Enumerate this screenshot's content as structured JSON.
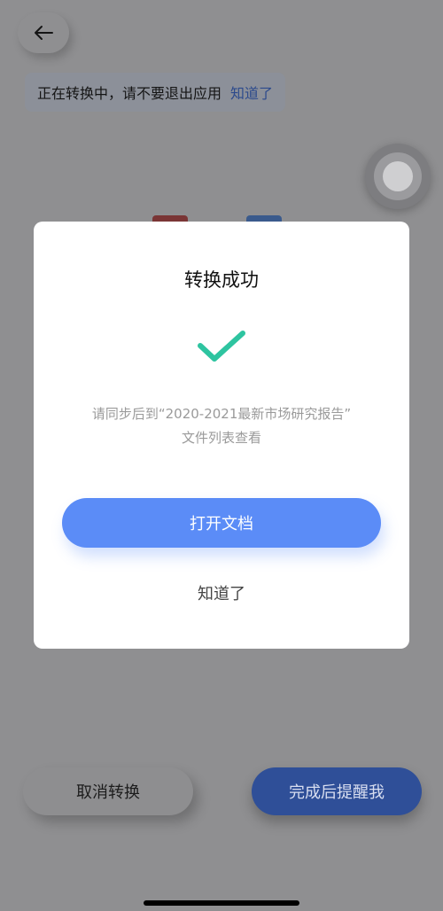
{
  "notice": {
    "text": "正在转换中，请不要退出应用",
    "link": "知道了"
  },
  "icons": {
    "back": "arrow-left-icon",
    "floating": "floating-ball-icon",
    "success": "checkmark-icon"
  },
  "modal": {
    "title": "转换成功",
    "message_line1": "请同步后到“2020-2021最新市场研究报告”",
    "message_line2": "文件列表查看",
    "open_button": "打开文档",
    "dismiss_button": "知道了"
  },
  "bottom": {
    "cancel_button": "取消转换",
    "remind_button": "完成后提醒我"
  },
  "colors": {
    "accent": "#5b8cf7",
    "success": "#2ec4a0",
    "overlay": "#8f8f91"
  }
}
